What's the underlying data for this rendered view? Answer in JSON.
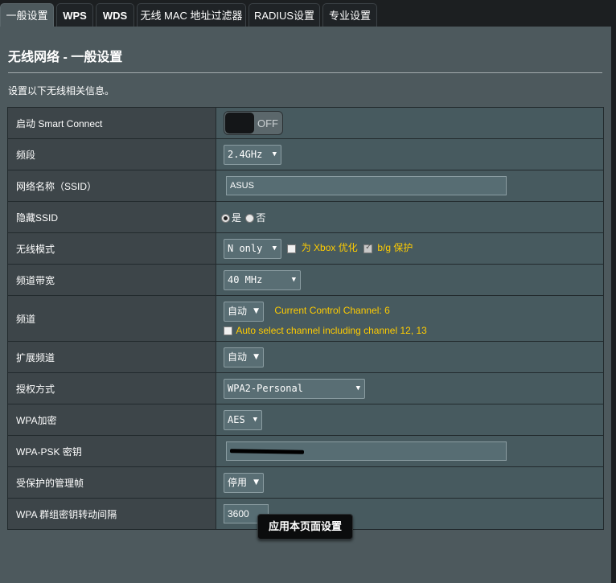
{
  "tabs": [
    {
      "label": "一般设置"
    },
    {
      "label": "WPS"
    },
    {
      "label": "WDS"
    },
    {
      "label": "无线 MAC 地址过滤器"
    },
    {
      "label": "RADIUS设置"
    },
    {
      "label": "专业设置"
    }
  ],
  "page": {
    "title": "无线网络 - 一般设置",
    "description": "设置以下无线相关信息。",
    "apply_label": "应用本页面设置"
  },
  "rows": {
    "smart_connect": {
      "label": "启动 Smart Connect",
      "toggle": "OFF"
    },
    "band": {
      "label": "频段",
      "value": "2.4GHz"
    },
    "ssid": {
      "label": "网络名称（SSID）",
      "value": "ASUS"
    },
    "hide_ssid": {
      "label": "隐藏SSID",
      "yes": "是",
      "no": "否"
    },
    "wireless_mode": {
      "label": "无线模式",
      "value": "N only",
      "xbox_label": "为 Xbox 优化",
      "bg_label": "b/g 保护"
    },
    "bandwidth": {
      "label": "频道带宽",
      "value": "40 MHz"
    },
    "channel": {
      "label": "频道",
      "value": "自动",
      "current_info": "Current Control Channel: 6",
      "auto_label": "Auto select channel including channel 12, 13"
    },
    "ext_channel": {
      "label": "扩展频道",
      "value": "自动"
    },
    "auth": {
      "label": "授权方式",
      "value": "WPA2-Personal"
    },
    "wpa_enc": {
      "label": "WPA加密",
      "value": "AES"
    },
    "psk": {
      "label": "WPA-PSK 密钥"
    },
    "pmf": {
      "label": "受保护的管理帧",
      "value": "停用"
    },
    "rekey": {
      "label": "WPA 群组密钥转动间隔",
      "value": "3600"
    }
  }
}
